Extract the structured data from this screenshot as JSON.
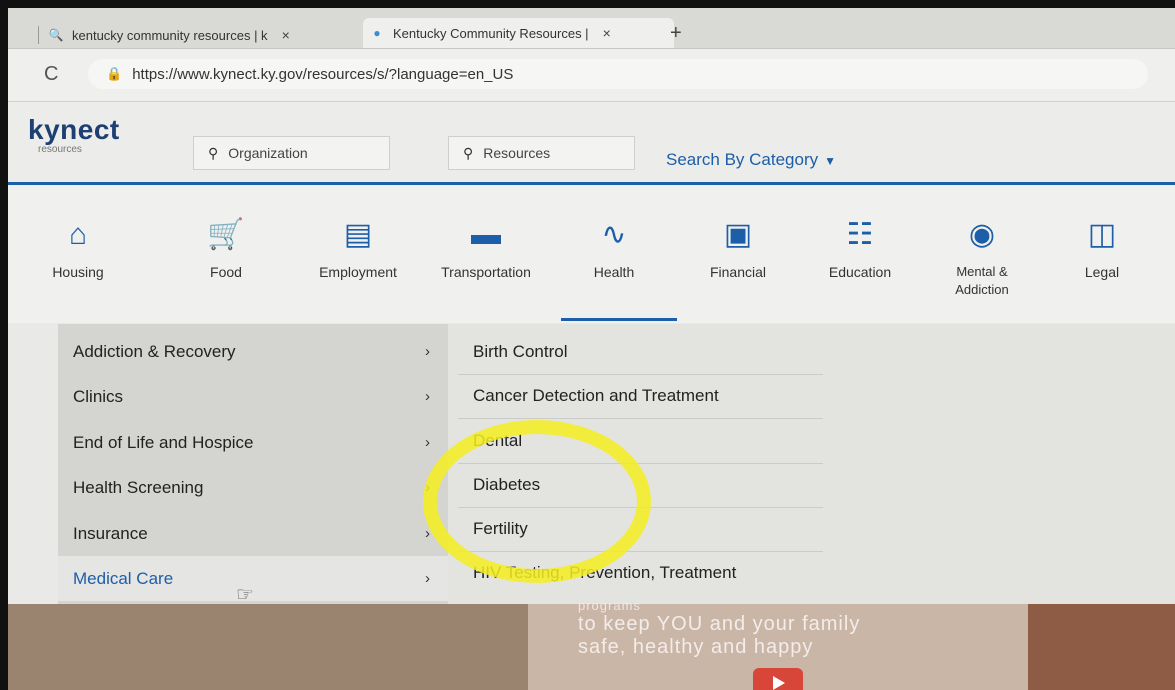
{
  "browser": {
    "tabs": [
      {
        "label": "kentucky community resources | k",
        "icon": "search-icon"
      },
      {
        "label": "Kentucky Community Resources |",
        "icon": "location-pin-icon"
      }
    ],
    "tab_close": "×",
    "new_tab": "+",
    "reload": "C",
    "url": "https://www.kynect.ky.gov/resources/s/?language=en_US"
  },
  "header": {
    "logo_main": "kynect",
    "logo_sub": "resources",
    "search_org_placeholder": "Organization",
    "search_res_placeholder": "Resources",
    "category_label": "Search By Category"
  },
  "categories": [
    {
      "label": "Housing",
      "icon": "house-icon"
    },
    {
      "label": "Food",
      "icon": "cart-icon"
    },
    {
      "label": "Employment",
      "icon": "id-card-icon"
    },
    {
      "label": "Transportation",
      "icon": "car-icon"
    },
    {
      "label": "Health",
      "icon": "heartbeat-icon"
    },
    {
      "label": "Financial",
      "icon": "money-icon"
    },
    {
      "label": "Education",
      "icon": "document-icon"
    },
    {
      "label": "Mental &",
      "label2": "Addiction",
      "icon": "chat-bubble-icon"
    },
    {
      "label": "Legal",
      "icon": "book-icon"
    }
  ],
  "health_menu": {
    "left": [
      {
        "label": "Addiction & Recovery"
      },
      {
        "label": "Clinics"
      },
      {
        "label": "End of Life and Hospice"
      },
      {
        "label": "Health Screening"
      },
      {
        "label": "Insurance"
      },
      {
        "label": "Medical Care",
        "active": true
      }
    ],
    "right": [
      {
        "label": "Birth Control"
      },
      {
        "label": "Cancer Detection and Treatment"
      },
      {
        "label": "Dental"
      },
      {
        "label": "Diabetes"
      },
      {
        "label": "Fertility"
      },
      {
        "label": "HIV Testing, Prevention, Treatment"
      }
    ],
    "chevron": "›"
  },
  "hero": {
    "line1": "programs",
    "line2": "to keep YOU and your family",
    "line3": "safe, healthy and happy"
  },
  "colors": {
    "brand_blue": "#1d5ea8",
    "highlight_yellow": "#f5ef1e"
  }
}
